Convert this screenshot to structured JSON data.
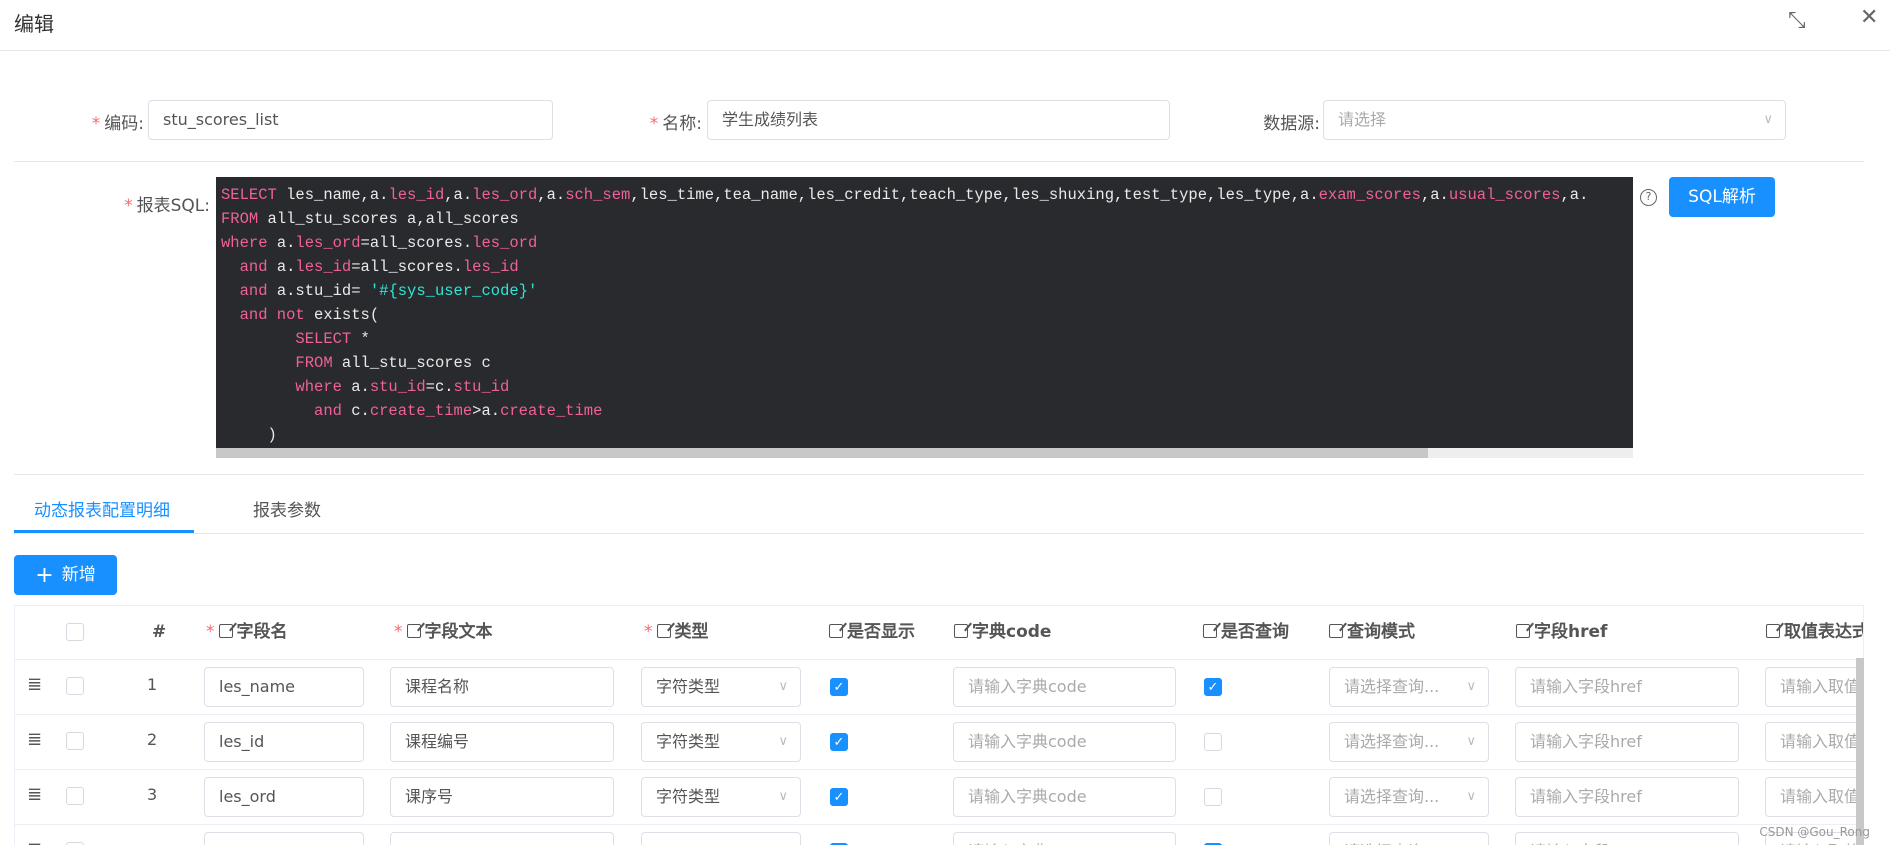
{
  "dialog": {
    "title": "编辑",
    "collapse_icon": "compress-icon",
    "close_icon": "close-icon"
  },
  "form": {
    "code": {
      "label": "编码:",
      "value": "stu_scores_list",
      "required": true
    },
    "name": {
      "label": "名称:",
      "value": "学生成绩列表",
      "required": true
    },
    "datasource": {
      "label": "数据源:",
      "placeholder": "请选择"
    },
    "sql": {
      "label": "报表SQL:",
      "required": true,
      "lines": [
        [
          [
            "SELECT",
            "k"
          ],
          [
            " les_name,a.",
            ""
          ],
          [
            "les_id",
            "k"
          ],
          [
            ",a.",
            ""
          ],
          [
            "les_ord",
            "k"
          ],
          [
            ",a.",
            ""
          ],
          [
            "sch_sem",
            "k"
          ],
          [
            ",les_time,tea_name,les_credit,teach_type,les_shuxing,test_type,les_type,a.",
            ""
          ],
          [
            "exam_scores",
            "k"
          ],
          [
            ",a.",
            ""
          ],
          [
            "usual_scores",
            "k"
          ],
          [
            ",a.",
            ""
          ]
        ],
        [
          [
            "FROM",
            "k"
          ],
          [
            " all_stu_scores a,all_scores",
            ""
          ]
        ],
        [
          [
            "where",
            "k"
          ],
          [
            " a.",
            ""
          ],
          [
            "les_ord",
            "k"
          ],
          [
            "=all_scores.",
            ""
          ],
          [
            "les_ord",
            "k"
          ]
        ],
        [
          [
            "  and",
            "k"
          ],
          [
            " a.",
            ""
          ],
          [
            "les_id",
            "k"
          ],
          [
            "=all_scores.",
            ""
          ],
          [
            "les_id",
            "k"
          ]
        ],
        [
          [
            "  and",
            "k"
          ],
          [
            " a.stu_id= ",
            ""
          ],
          [
            "'#{sys_user_code}'",
            "s"
          ]
        ],
        [
          [
            "  and not",
            "k"
          ],
          [
            " exists(",
            ""
          ]
        ],
        [
          [
            "        SELECT",
            "k"
          ],
          [
            " *",
            ""
          ]
        ],
        [
          [
            "        FROM",
            "k"
          ],
          [
            " all_stu_scores c",
            ""
          ]
        ],
        [
          [
            "        where",
            "k"
          ],
          [
            " a.",
            ""
          ],
          [
            "stu_id",
            "k"
          ],
          [
            "=c.",
            ""
          ],
          [
            "stu_id",
            "k"
          ]
        ],
        [
          [
            "          and",
            "k"
          ],
          [
            " c.",
            ""
          ],
          [
            "create_time",
            "k"
          ],
          [
            ">a.",
            ""
          ],
          [
            "create_time",
            "k"
          ]
        ],
        [
          [
            "     )",
            ""
          ]
        ]
      ]
    },
    "help_icon": "question-circle-icon",
    "parse_button": "SQL解析"
  },
  "tabs": [
    {
      "label": "动态报表配置明细",
      "active": true
    },
    {
      "label": "报表参数",
      "active": false
    }
  ],
  "add_button": "新增",
  "table": {
    "headers": [
      "#",
      "字段名",
      "字段文本",
      "类型",
      "是否显示",
      "字典code",
      "是否查询",
      "查询模式",
      "字段href",
      "取值表达式"
    ],
    "placeholders": {
      "dict_code": "请输入字典code",
      "query_mode": "请选择查询...",
      "href": "请输入字段href",
      "expr": "请输入取值"
    },
    "rows": [
      {
        "index": "1",
        "field_name": "les_name",
        "field_text": "课程名称",
        "type": "字符类型",
        "show": true,
        "query": true
      },
      {
        "index": "2",
        "field_name": "les_id",
        "field_text": "课程编号",
        "type": "字符类型",
        "show": true,
        "query": false
      },
      {
        "index": "3",
        "field_name": "les_ord",
        "field_text": "课序号",
        "type": "字符类型",
        "show": true,
        "query": false
      },
      {
        "index": "",
        "field_name": "",
        "field_text": "",
        "type": "",
        "show": true,
        "query": true
      }
    ]
  },
  "watermark": "CSDN @Gou_Rong",
  "colors": {
    "primary": "#1890ff",
    "required": "#f56c6c",
    "editor_bg": "#282a2e",
    "keyword": "#f0609a",
    "string": "#2ee6d6"
  }
}
